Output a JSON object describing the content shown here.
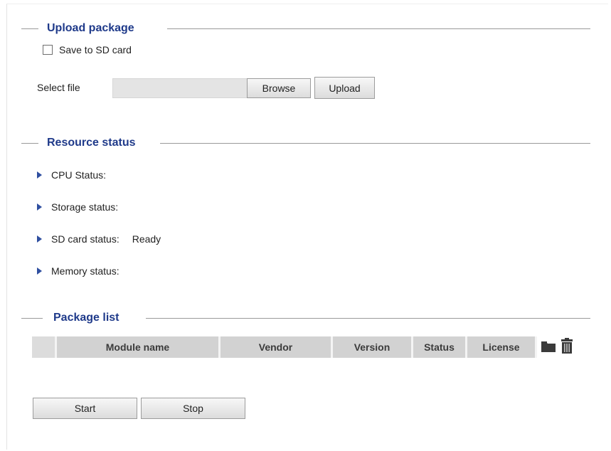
{
  "upload_package": {
    "title": "Upload package",
    "save_to_sd": {
      "label": "Save to SD card",
      "checked": false
    },
    "select_file_label": "Select file",
    "browse_label": "Browse",
    "upload_label": "Upload"
  },
  "resource_status": {
    "title": "Resource status",
    "items": [
      {
        "label": "CPU Status:",
        "value": ""
      },
      {
        "label": "Storage status:",
        "value": ""
      },
      {
        "label": "SD card status:",
        "value": "Ready"
      },
      {
        "label": "Memory status:",
        "value": ""
      }
    ]
  },
  "package_list": {
    "title": "Package list",
    "columns": [
      "",
      "Module name",
      "Vendor",
      "Version",
      "Status",
      "License"
    ],
    "icons": [
      "folder-icon",
      "trash-icon"
    ]
  },
  "actions": {
    "start_label": "Start",
    "stop_label": "Stop"
  },
  "colors": {
    "heading": "#1f3a8a",
    "chevron": "#2f4fa0",
    "table_header_bg": "#d2d2d2"
  }
}
